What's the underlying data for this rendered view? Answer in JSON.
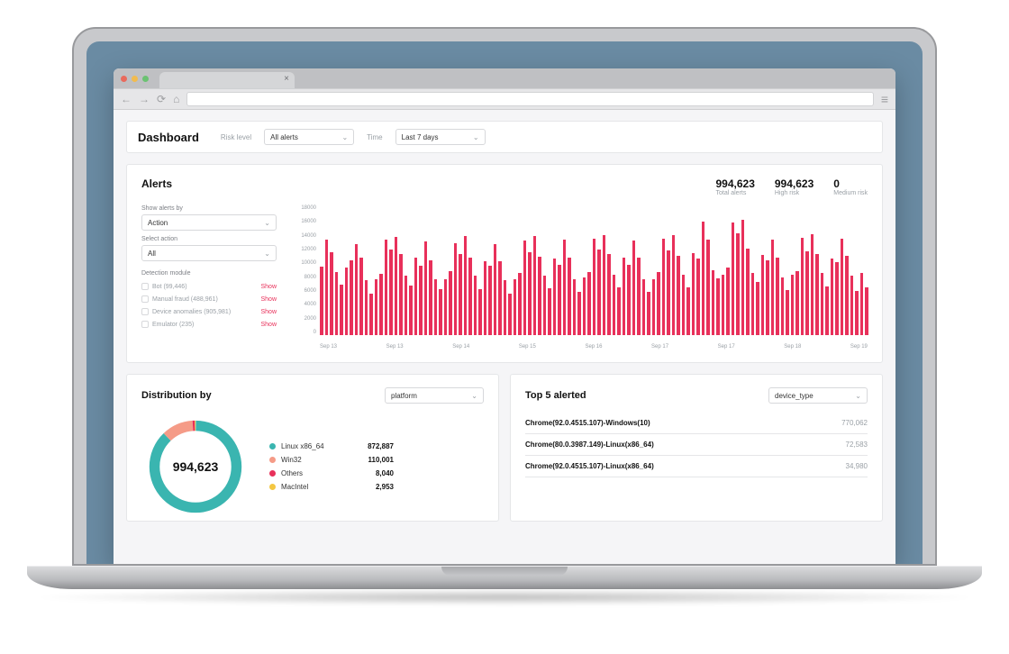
{
  "header": {
    "title": "Dashboard",
    "risk_level_label": "Risk level",
    "risk_level_value": "All alerts",
    "time_label": "Time",
    "time_value": "Last 7 days"
  },
  "alerts": {
    "title": "Alerts",
    "stats": [
      {
        "value": "994,623",
        "label": "Total alerts"
      },
      {
        "value": "994,623",
        "label": "High risk"
      },
      {
        "value": "0",
        "label": "Medium risk"
      }
    ],
    "show_by_label": "Show alerts by",
    "show_by_value": "Action",
    "select_action_label": "Select action",
    "select_action_value": "All",
    "modules_label": "Detection module",
    "modules": [
      {
        "label": "Bot (99,446)",
        "action": "Show"
      },
      {
        "label": "Manual fraud (488,961)",
        "action": "Show"
      },
      {
        "label": "Device anomalies (905,981)",
        "action": "Show"
      },
      {
        "label": "Emulator (235)",
        "action": "Show"
      }
    ]
  },
  "distribution": {
    "title": "Distribution by",
    "selector": "platform",
    "center_value": "994,623",
    "legend": [
      {
        "color": "#3ab5b0",
        "name": "Linux x86_64",
        "value": "872,887"
      },
      {
        "color": "#f59b87",
        "name": "Win32",
        "value": "110,001"
      },
      {
        "color": "#e8305a",
        "name": "Others",
        "value": "8,040"
      },
      {
        "color": "#f4c742",
        "name": "MacIntel",
        "value": "2,953"
      }
    ]
  },
  "top5": {
    "title": "Top 5 alerted",
    "selector": "device_type",
    "items": [
      {
        "name": "Chrome(92.0.4515.107)-Windows(10)",
        "value": "770,062"
      },
      {
        "name": "Chrome(80.0.3987.149)-Linux(x86_64)",
        "value": "72,583"
      },
      {
        "name": "Chrome(92.0.4515.107)-Linux(x86_64)",
        "value": "34,980"
      }
    ]
  },
  "chart_data": {
    "type": "bar",
    "title": "Alerts",
    "ylabel": "",
    "ylim": [
      0,
      18000
    ],
    "yticks": [
      0,
      2000,
      4000,
      6000,
      8000,
      10000,
      12000,
      14000,
      16000,
      18000
    ],
    "xlabel": "",
    "xticks": [
      "Sep 13",
      "Sep 13",
      "Sep 14",
      "Sep 15",
      "Sep 16",
      "Sep 17",
      "Sep 17",
      "Sep 18",
      "Sep 19"
    ],
    "values": [
      9500,
      13200,
      11500,
      8800,
      7000,
      9400,
      10400,
      12600,
      10800,
      7600,
      5800,
      7800,
      8500,
      13300,
      11900,
      13600,
      11200,
      8300,
      6900,
      10800,
      9600,
      13000,
      10400,
      7700,
      6400,
      7700,
      8900,
      12800,
      11200,
      13700,
      10700,
      8300,
      6400,
      10300,
      9600,
      12600,
      10300,
      7600,
      5800,
      7700,
      8600,
      13100,
      11500,
      13700,
      10900,
      8300,
      6500,
      10600,
      9800,
      13200,
      10800,
      7800,
      6000,
      8000,
      8800,
      13400,
      11900,
      13900,
      11200,
      8400,
      6600,
      10700,
      9700,
      13100,
      10700,
      7700,
      6000,
      7800,
      8800,
      13400,
      11800,
      13900,
      11000,
      8400,
      6600,
      11400,
      10600,
      15700,
      13200,
      9000,
      7900,
      8400,
      9400,
      15600,
      14100,
      16000,
      12000,
      8600,
      7400,
      11100,
      10400,
      13200,
      10800,
      8000,
      6200,
      8400,
      8900,
      13500,
      11600,
      14000,
      11300,
      8600,
      6700,
      10600,
      10100,
      13400,
      11000,
      8200,
      6100,
      8600,
      6600
    ]
  }
}
